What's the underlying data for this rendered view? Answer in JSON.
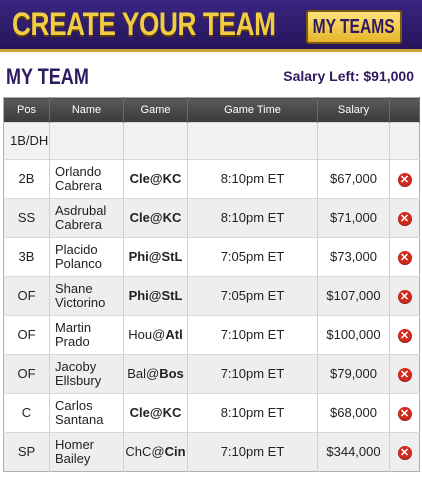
{
  "header": {
    "title": "CREATE YOUR TEAM",
    "my_teams_label": "MY TEAMS"
  },
  "team": {
    "title": "MY TEAM",
    "salary_left": "Salary Left: $91,000"
  },
  "columns": [
    "Pos",
    "Name",
    "Game",
    "Game Time",
    "Salary"
  ],
  "empty_slot": {
    "pos": "1B/DH"
  },
  "rows": [
    {
      "pos": "2B",
      "first": "Orlando",
      "last": "Cabrera",
      "away": "Cle",
      "sep": "@",
      "home": "KC",
      "bold": "both",
      "time": "8:10pm ET",
      "salary": "$67,000"
    },
    {
      "pos": "SS",
      "first": "Asdrubal",
      "last": "Cabrera",
      "away": "Cle",
      "sep": "@",
      "home": "KC",
      "bold": "both",
      "time": "8:10pm ET",
      "salary": "$71,000"
    },
    {
      "pos": "3B",
      "first": "Placido",
      "last": "Polanco",
      "away": "Phi",
      "sep": "@",
      "home": "StL",
      "bold": "both",
      "time": "7:05pm ET",
      "salary": "$73,000"
    },
    {
      "pos": "OF",
      "first": "Shane",
      "last": "Victorino",
      "away": "Phi",
      "sep": "@",
      "home": "StL",
      "bold": "both",
      "time": "7:05pm ET",
      "salary": "$107,000"
    },
    {
      "pos": "OF",
      "first": "Martin",
      "last": "Prado",
      "away": "Hou",
      "sep": "@",
      "home": "Atl",
      "bold": "home",
      "time": "7:10pm ET",
      "salary": "$100,000"
    },
    {
      "pos": "OF",
      "first": "Jacoby",
      "last": "Ellsbury",
      "away": "Bal",
      "sep": "@",
      "home": "Bos",
      "bold": "home",
      "time": "7:10pm ET",
      "salary": "$79,000"
    },
    {
      "pos": "C",
      "first": "Carlos",
      "last": "Santana",
      "away": "Cle",
      "sep": "@",
      "home": "KC",
      "bold": "both",
      "time": "8:10pm ET",
      "salary": "$68,000"
    },
    {
      "pos": "SP",
      "first": "Homer",
      "last": "Bailey",
      "away": "ChC",
      "sep": "@",
      "home": "Cin",
      "bold": "home",
      "time": "7:10pm ET",
      "salary": "$344,000"
    }
  ],
  "icons": {
    "remove": "remove-icon"
  },
  "colors": {
    "banner_bg": "#2e1a6e",
    "banner_text": "#f0cd43",
    "heading": "#2e1a5e",
    "remove": "#d02a1e"
  }
}
